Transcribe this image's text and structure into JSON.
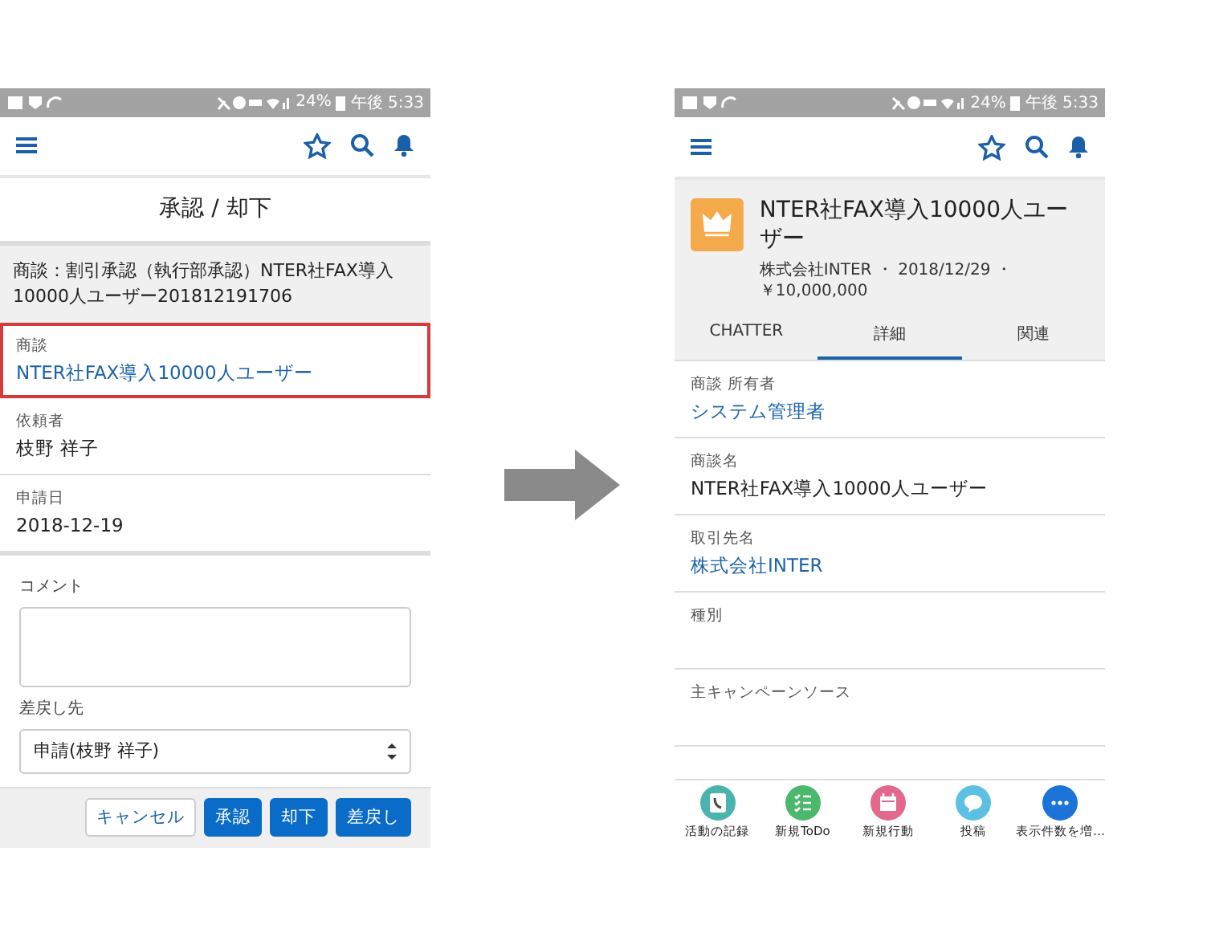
{
  "approval_screen": {
    "status_bar": {
      "battery": "24%",
      "time": "午後 5:33"
    },
    "title": "承認 / 却下",
    "summary": "商談：割引承認（執行部承認）NTER社FAX導入10000人ユーザー201812191706",
    "fields": [
      {
        "label": "商談",
        "value": "NTER社FAX導入10000人ユーザー",
        "kind": "link",
        "highlighted": true
      },
      {
        "label": "依頼者",
        "value": "枝野 祥子",
        "kind": "text",
        "highlighted": false
      },
      {
        "label": "申請日",
        "value": "2018-12-19",
        "kind": "text",
        "highlighted": false
      }
    ],
    "comment": {
      "label": "コメント"
    },
    "return_to": {
      "label": "差戻し先",
      "value": "申請(枝野 祥子)"
    },
    "buttons": [
      {
        "label": "キャンセル",
        "kind": "neutral"
      },
      {
        "label": "承認",
        "kind": "brand"
      },
      {
        "label": "却下",
        "kind": "brand"
      },
      {
        "label": "差戻し",
        "kind": "brand"
      }
    ]
  },
  "opportunity_screen": {
    "status_bar": {
      "battery": "24%",
      "time": "午後 5:33"
    },
    "record": {
      "title": "NTER社FAX導入10000人ユーザー",
      "subtitle": "株式会社INTER ・ 2018/12/29 ・￥10,000,000"
    },
    "tabs": [
      {
        "label": "CHATTER",
        "selected": false
      },
      {
        "label": "詳細",
        "selected": true
      },
      {
        "label": "関連",
        "selected": false
      }
    ],
    "fields": [
      {
        "label": "商談 所有者",
        "value": "システム管理者",
        "kind": "link"
      },
      {
        "label": "商談名",
        "value": "NTER社FAX導入10000人ユーザー",
        "kind": "text"
      },
      {
        "label": "取引先名",
        "value": "株式会社INTER",
        "kind": "link"
      },
      {
        "label": "種別"
      },
      {
        "label": "主キャンペーンソース"
      }
    ],
    "actions": [
      {
        "label": "活動の記録",
        "kind": "call",
        "color": "#4bb3ad"
      },
      {
        "label": "新規ToDo",
        "kind": "todo",
        "color": "#4cb86c"
      },
      {
        "label": "新規行動",
        "kind": "event",
        "color": "#e2688d"
      },
      {
        "label": "投稿",
        "kind": "post",
        "color": "#5cc0e3"
      },
      {
        "label": "表示件数を増…",
        "kind": "more",
        "color": "#1d74d8"
      }
    ]
  }
}
